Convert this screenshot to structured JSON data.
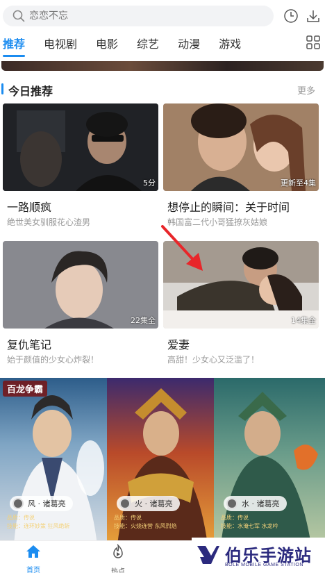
{
  "search": {
    "placeholder": "恋恋不忘"
  },
  "header": {
    "history_icon": "clock-icon",
    "download_icon": "download-icon"
  },
  "tabs": [
    {
      "label": "推荐",
      "active": true
    },
    {
      "label": "电视剧"
    },
    {
      "label": "电影"
    },
    {
      "label": "综艺"
    },
    {
      "label": "动漫"
    },
    {
      "label": "游戏"
    }
  ],
  "section": {
    "title": "今日推荐",
    "more": "更多"
  },
  "cards": [
    {
      "title": "一路顺疯",
      "subtitle": "绝世美女驯服花心渣男",
      "badge": "5分"
    },
    {
      "title": "想停止的瞬间：关于时间",
      "subtitle": "韩国富二代小哥猛撩灰姑娘",
      "badge": "更新至4集"
    },
    {
      "title": "复仇笔记",
      "subtitle": "始于颜值的少女心炸裂！",
      "badge": "22集全"
    },
    {
      "title": "爱妻",
      "subtitle": "高甜！少女心又泛滥了！",
      "badge": "14集全"
    }
  ],
  "game_ad": {
    "logo": "百龙争霸",
    "heroes": [
      {
        "label": "风 · 诸葛亮",
        "quality": "品质：传说",
        "skill": "技能：连环妙策  狂风绝斩"
      },
      {
        "label": "火 · 诸葛亮",
        "quality": "品质：传说",
        "skill": "技能：火烧连营  东风烈焰"
      },
      {
        "label": "水 · 诸葛亮",
        "quality": "品质：传说",
        "skill": "技能：水淹七军  水龙吟"
      }
    ]
  },
  "bottom_nav": [
    {
      "label": "首页",
      "icon": "home-icon",
      "active": true
    },
    {
      "label": "热点",
      "icon": "hot-play-icon"
    }
  ],
  "watermark": {
    "title": "伯乐手游站",
    "subtitle": "BOLE MOBILE GAME STATION"
  },
  "colors": {
    "accent": "#1b8cf0",
    "watermark": "#2b2a7e",
    "arrow": "#e8262a"
  }
}
